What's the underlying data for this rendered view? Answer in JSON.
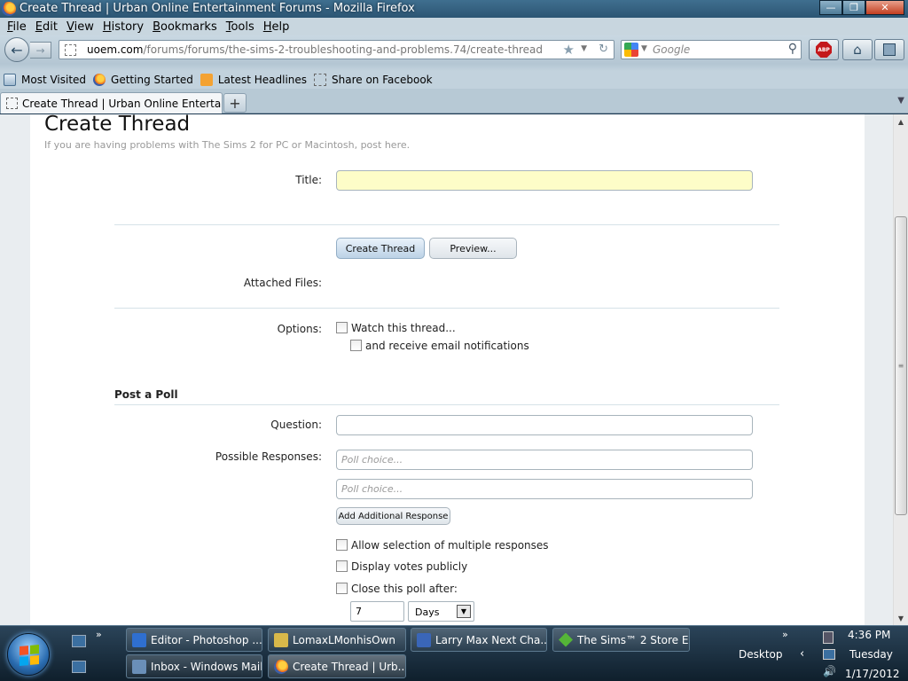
{
  "window": {
    "title": "Create Thread | Urban Online Entertainment Forums - Mozilla Firefox",
    "minimize": "—",
    "maximize": "❐",
    "close": "✕"
  },
  "menu": [
    "File",
    "Edit",
    "View",
    "History",
    "Bookmarks",
    "Tools",
    "Help"
  ],
  "nav": {
    "url_domain": "uoem.com",
    "url_path": "/forums/forums/the-sims-2-troubleshooting-and-problems.74/create-thread",
    "search_placeholder": "Google",
    "abp_label": "ABP"
  },
  "bookmarks": [
    {
      "label": "Most Visited",
      "icon": "most-visited-icon"
    },
    {
      "label": "Getting Started",
      "icon": "firefox-icon"
    },
    {
      "label": "Latest Headlines",
      "icon": "rss-icon"
    },
    {
      "label": "Share on Facebook",
      "icon": "page-icon"
    }
  ],
  "tabs": [
    {
      "label": "Create Thread | Urban Online Entertainm...",
      "active": true
    }
  ],
  "page": {
    "heading": "Create Thread",
    "subtitle": "If you are having problems with The Sims 2 for PC or Macintosh, post here.",
    "title_label": "Title:",
    "title_value": "",
    "create_button": "Create Thread",
    "preview_button": "Preview...",
    "attached_label": "Attached Files:",
    "options_label": "Options:",
    "watch_label": "Watch this thread...",
    "email_label": "and receive email notifications",
    "poll_heading": "Post a Poll",
    "question_label": "Question:",
    "question_value": "",
    "responses_label": "Possible Responses:",
    "choice_placeholder": "Poll choice...",
    "add_response_button": "Add Additional Response",
    "multiple_label": "Allow selection of multiple responses",
    "public_label": "Display votes publicly",
    "close_label": "Close this poll after:",
    "close_value": "7",
    "close_unit": "Days"
  },
  "taskbar": {
    "items": [
      {
        "label": "Editor - Photoshop ...",
        "icon": "photoshop-icon",
        "color": "#2f6fd0"
      },
      {
        "label": "LomaxLMonhisOwn",
        "icon": "folder-icon",
        "color": "#d8b84a"
      },
      {
        "label": "Larry Max Next Cha...",
        "icon": "word-doc-icon",
        "color": "#3a66b8"
      },
      {
        "label": "The Sims™ 2 Store E...",
        "icon": "sims-plumbob-icon",
        "color": "#55b537"
      },
      {
        "label": "Inbox - Windows Mail",
        "icon": "mail-icon",
        "color": "#6a8fb8"
      },
      {
        "label": "Create Thread | Urb...",
        "icon": "firefox-icon",
        "color": "#e8631b"
      }
    ],
    "desktop_label": "Desktop",
    "time": "4:36 PM",
    "day": "Tuesday",
    "date": "1/17/2012"
  }
}
